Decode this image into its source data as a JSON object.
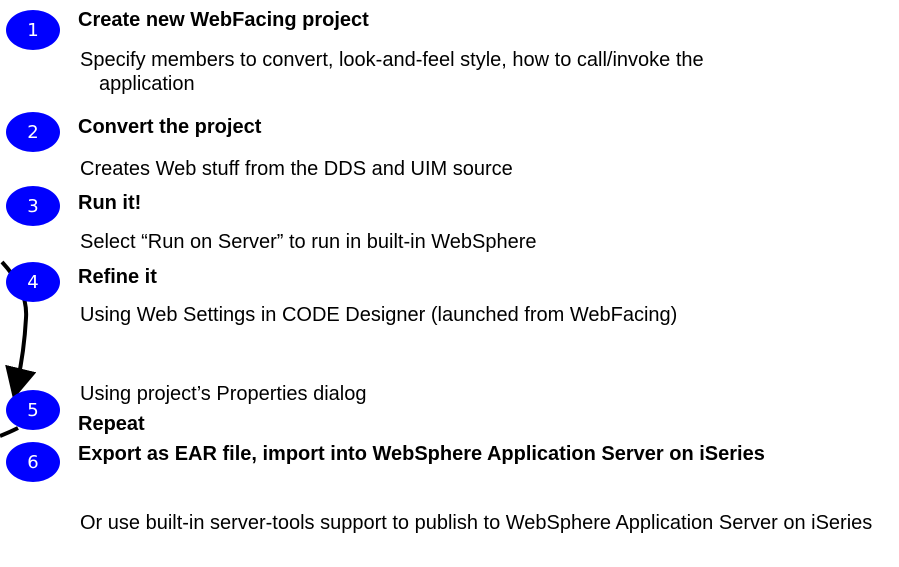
{
  "steps": [
    {
      "number": "1",
      "title": "Create new WebFacing project",
      "descriptions": [
        "Specify members to convert, look-and-feel style, how to call/invoke the application"
      ]
    },
    {
      "number": "2",
      "title": "Convert the project",
      "descriptions": [
        "Creates Web stuff from the DDS and UIM source"
      ]
    },
    {
      "number": "3",
      "title": "Run it!",
      "descriptions": [
        "Select “Run on Server” to run in built-in WebSphere"
      ]
    },
    {
      "number": "4",
      "title": "Refine it",
      "descriptions": [
        "Using Web Settings in CODE Designer (launched from WebFacing)",
        "Using project’s Properties dialog"
      ]
    },
    {
      "number": "5",
      "title": "Repeat",
      "descriptions": []
    },
    {
      "number": "6",
      "title": "Export as EAR file, import into WebSphere Application Server on iSeries",
      "descriptions": [
        "Or use built-in server-tools support to publish to WebSphere Application Server on iSeries"
      ]
    }
  ],
  "colors": {
    "badge": "#0000ff",
    "badge_text": "#ffffff",
    "arrow": "#000000"
  }
}
